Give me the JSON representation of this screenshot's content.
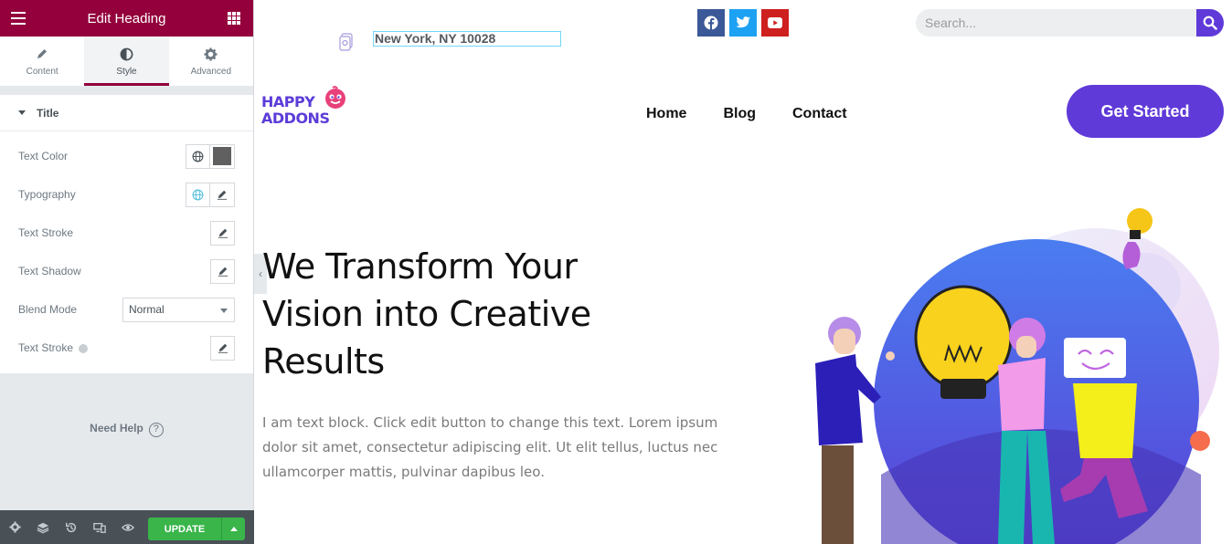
{
  "editor": {
    "header": {
      "title": "Edit Heading"
    },
    "tabs": [
      {
        "label": "Content",
        "icon": "pencil-icon"
      },
      {
        "label": "Style",
        "icon": "contrast-icon",
        "active": true
      },
      {
        "label": "Advanced",
        "icon": "gear-icon"
      }
    ],
    "section": {
      "title": "Title",
      "controls": {
        "text_color": "Text Color",
        "typography": "Typography",
        "text_stroke": "Text Stroke",
        "text_shadow": "Text Shadow",
        "blend_mode": "Blend Mode",
        "blend_mode_value": "Normal",
        "text_stroke_2": "Text Stroke"
      },
      "text_color_value": "#606060"
    },
    "help": "Need Help",
    "footer": {
      "update_label": "UPDATE"
    }
  },
  "site": {
    "address": "New York, NY 10028",
    "socials": [
      "facebook-icon",
      "twitter-icon",
      "youtube-icon"
    ],
    "search_placeholder": "Search...",
    "logo": {
      "line1": "HAPPY",
      "line2": "ADDONS"
    },
    "nav": [
      "Home",
      "Blog",
      "Contact"
    ],
    "cta": "Get Started",
    "hero": {
      "title": "We Transform Your Vision into Creative Results",
      "text": "I am text block. Click edit button to change this text. Lorem ipsum dolor sit amet, consectetur adipiscing elit. Ut elit tellus, luctus nec ullamcorper mattis, pulvinar dapibus leo."
    }
  },
  "colors": {
    "editor_accent": "#93003c",
    "brand_purple": "#5f3ad8",
    "update_green": "#39b54a"
  }
}
